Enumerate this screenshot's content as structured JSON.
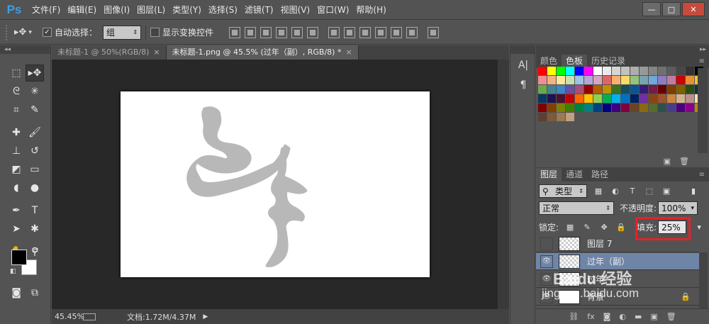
{
  "app": {
    "logo": "Ps",
    "menu": [
      "文件(F)",
      "编辑(E)",
      "图像(I)",
      "图层(L)",
      "类型(Y)",
      "选择(S)",
      "滤镜(T)",
      "视图(V)",
      "窗口(W)",
      "帮助(H)"
    ],
    "window_controls": {
      "minimize": "—",
      "restore": "□",
      "close": "✕"
    }
  },
  "options_bar": {
    "auto_select_label": "自动选择：",
    "auto_select_value": "组",
    "show_transform_label": "显示变换控件"
  },
  "documents": {
    "tabs": [
      {
        "label": "未标题-1 @ 50%(RGB/8)",
        "close": "×"
      },
      {
        "label": "未标题-1.png @ 45.5% (过年（副）, RGB/8) *",
        "close": "×"
      }
    ]
  },
  "status": {
    "zoom": "45.45%",
    "doc_info": "文档:1.72M/4.37M"
  },
  "right_panel": {
    "color_tabs": [
      "颜色",
      "色板",
      "历史记录"
    ],
    "swatches": [
      "#ff0000",
      "#ffff00",
      "#00ff00",
      "#00ffff",
      "#0000ff",
      "#ff00ff",
      "#ffffff",
      "#ebebeb",
      "#d6d6d6",
      "#c2c2c2",
      "#adadad",
      "#999999",
      "#858585",
      "#707070",
      "#5c5c5c",
      "#474747",
      "#333333",
      "#000000",
      "#ee8f8f",
      "#f4b183",
      "#ffe699",
      "#c5e0b3",
      "#9dc3e6",
      "#b4a7d6",
      "#d5a6bd",
      "#e06666",
      "#f6b26b",
      "#ffd966",
      "#93c47d",
      "#76a5af",
      "#6fa8dc",
      "#8e7cc3",
      "#c27ba0",
      "#cc0000",
      "#e69138",
      "#f1c232",
      "#6aa84f",
      "#45818e",
      "#3d85c6",
      "#674ea7",
      "#a64d79",
      "#990000",
      "#b45f06",
      "#bf9000",
      "#38761d",
      "#134f5c",
      "#0b5394",
      "#351c75",
      "#741b47",
      "#660000",
      "#783f04",
      "#7f6000",
      "#274e13",
      "#0c343d",
      "#073763",
      "#20124d",
      "#4c1130",
      "#c00000",
      "#ff6600",
      "#ffc000",
      "#92d050",
      "#00b050",
      "#00b0f0",
      "#0070c0",
      "#002060",
      "#7030a0",
      "#8b4513",
      "#a0522d",
      "#cd853f",
      "#d2b48c",
      "#bc8f8f",
      "#f5deb3",
      "#800000",
      "#804000",
      "#808000",
      "#408000",
      "#008040",
      "#008080",
      "#004080",
      "#000080",
      "#400080",
      "#800040",
      "#6b4423",
      "#8b6914",
      "#556b2f",
      "#2f4f4f",
      "#483d8b",
      "#4b0082",
      "#8b008b",
      "#b8860b",
      "#5c4033",
      "#7b5b3a",
      "#9c7a54",
      "#c0a080"
    ],
    "layers_tabs": [
      "图层",
      "通道",
      "路径"
    ],
    "kind_filter": "类型",
    "blend_mode": "正常",
    "opacity_label": "不透明度:",
    "opacity_value": "100%",
    "lock_label": "锁定:",
    "fill_label": "填充:",
    "fill_value": "25%",
    "layers": [
      {
        "name": "图层 7",
        "visible": false,
        "selected": false
      },
      {
        "name": "过年（副）",
        "visible": true,
        "selected": true
      },
      {
        "name": "过年",
        "visible": true,
        "selected": false
      },
      {
        "name": "背景",
        "visible": true,
        "selected": false,
        "locked": true
      }
    ]
  },
  "watermark": {
    "brand": "Baidu 经验",
    "url": "jingyan.baidu.com"
  }
}
